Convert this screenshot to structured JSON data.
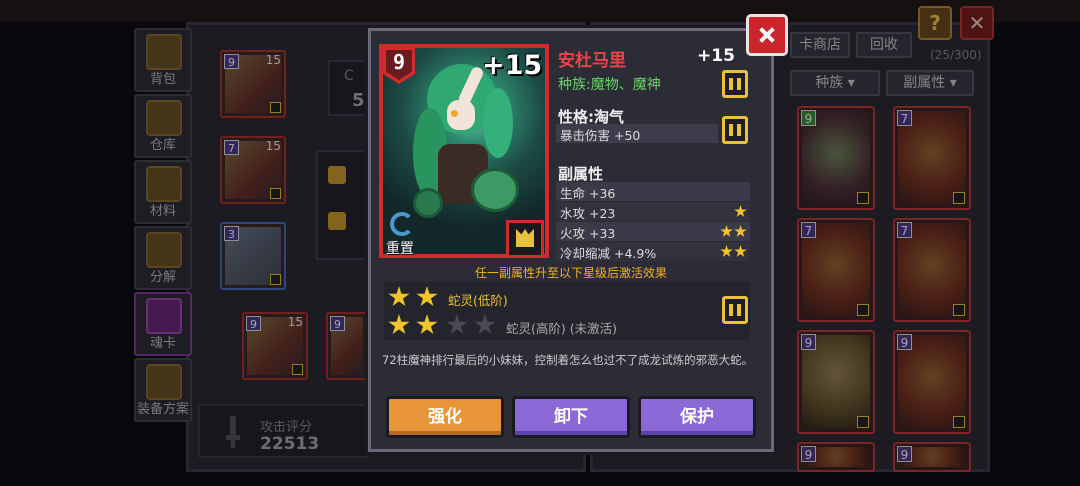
{
  "background": {
    "sidebar": [
      {
        "label": "背包",
        "icon": "backpack-icon"
      },
      {
        "label": "仓库",
        "icon": "warehouse-icon"
      },
      {
        "label": "材料",
        "icon": "materials-icon"
      },
      {
        "label": "分解",
        "icon": "decompose-icon"
      },
      {
        "label": "魂卡",
        "icon": "soul-card-icon",
        "active": true
      },
      {
        "label": "装备方案",
        "icon": "equipment-plan-icon"
      }
    ],
    "equipped_cards": [
      {
        "level": "9",
        "plus": "15"
      },
      {
        "level": "7",
        "plus": "15"
      },
      {
        "level": "3",
        "plus": ""
      },
      {
        "level": "9",
        "plus": "15"
      },
      {
        "level": "9",
        "plus": "15"
      }
    ],
    "left_partial": {
      "top_char": "C",
      "num": "5"
    },
    "toolbar": {
      "shop": "卡商店",
      "recycle": "回收",
      "count": "(25/300)",
      "race_filter": "种族",
      "sub_attr_filter": "副属性"
    },
    "grid_cards": [
      "9",
      "7",
      "7",
      "7",
      "9",
      "9",
      "9",
      "9"
    ],
    "score": {
      "label": "攻击评分",
      "value": "22513"
    }
  },
  "card": {
    "level": "9",
    "plus_badge": "+15",
    "reset_label": "重置",
    "name": "安杜马里",
    "name_plus": "+15",
    "race": "种族:魔物、魔神",
    "personality_title": "性格:淘气",
    "personality_effect": "暴击伤害 +50",
    "sub_attr_title": "副属性",
    "sub_attrs": [
      {
        "text": "生命 +36",
        "stars": 0
      },
      {
        "text": "水攻 +23",
        "stars": 1
      },
      {
        "text": "火攻 +33",
        "stars": 2
      },
      {
        "text": "冷却缩减 +4.9%",
        "stars": 2
      }
    ],
    "hint": "任一副属性升至以下星级后激活效果",
    "set_effects": [
      {
        "text": "蛇灵(低阶)",
        "stars_on": 2,
        "stars_off": 0
      },
      {
        "text": "蛇灵(高阶) (未激活)",
        "stars_on": 2,
        "stars_off": 2
      }
    ],
    "description": "72柱魔神排行最后的小妹妹，控制着怎么也过不了成龙试炼的邪恶大蛇。"
  },
  "actions": {
    "strengthen": "强化",
    "unequip": "卸下",
    "protect": "保护"
  },
  "colors": {
    "accent_red": "#d22b2d",
    "gold": "#e8c23c",
    "orange_btn": "#e8953a",
    "purple_btn": "#8a68d6",
    "race_green": "#69d36a"
  }
}
